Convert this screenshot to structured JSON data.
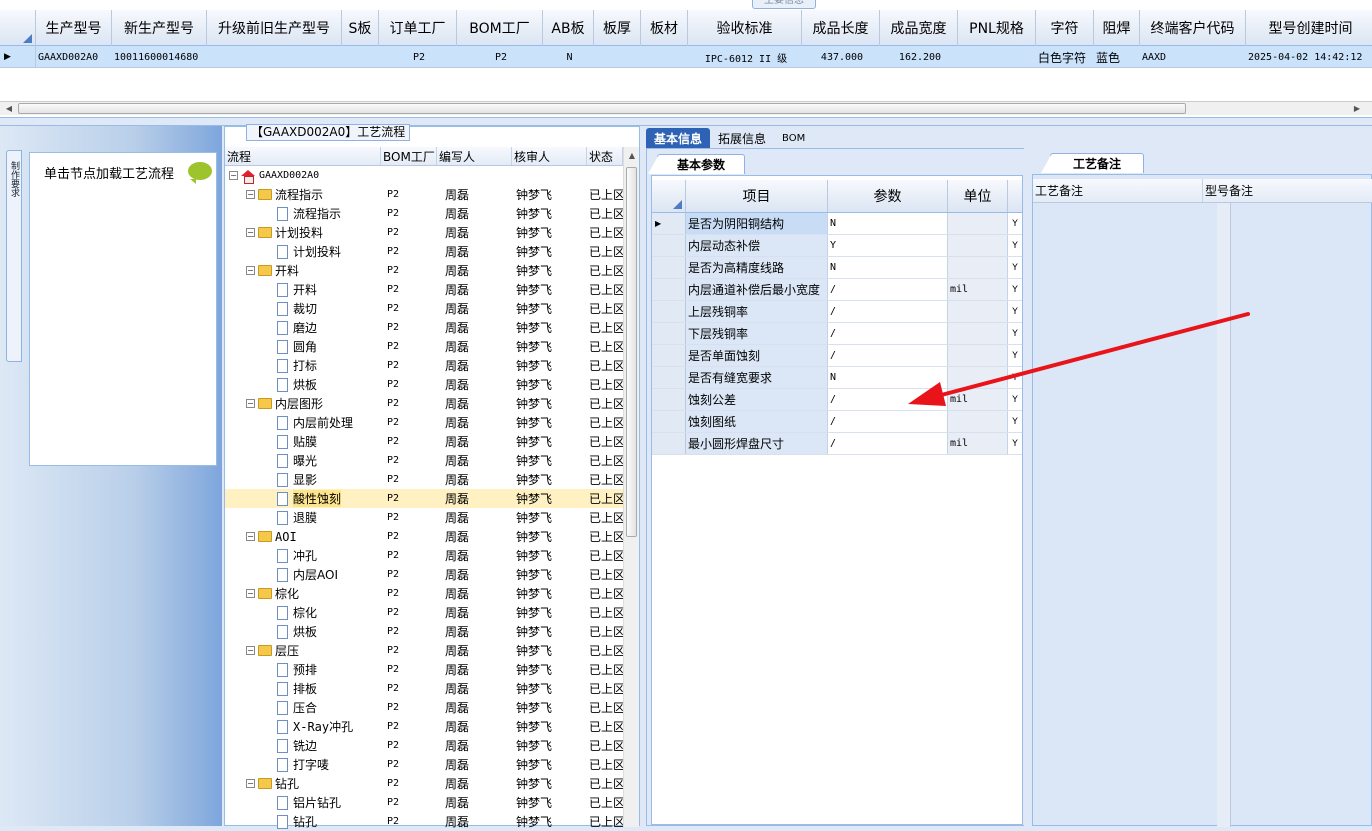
{
  "top_grid": {
    "tab_label": "主要信息",
    "columns": [
      {
        "label": "生产型号",
        "w": 76
      },
      {
        "label": "新生产型号",
        "w": 95
      },
      {
        "label": "升级前旧生产型号",
        "w": 135
      },
      {
        "label": "S板",
        "w": 37
      },
      {
        "label": "订单工厂",
        "w": 78
      },
      {
        "label": "BOM工厂",
        "w": 86
      },
      {
        "label": "AB板",
        "w": 51
      },
      {
        "label": "板厚",
        "w": 47
      },
      {
        "label": "板材",
        "w": 47
      },
      {
        "label": "验收标准",
        "w": 114
      },
      {
        "label": "成品长度",
        "w": 78
      },
      {
        "label": "成品宽度",
        "w": 78
      },
      {
        "label": "PNL规格",
        "w": 78
      },
      {
        "label": "字符",
        "w": 58
      },
      {
        "label": "阻焊",
        "w": 46
      },
      {
        "label": "终端客户代码",
        "w": 106
      },
      {
        "label": "型号创建时间",
        "w": 130
      }
    ],
    "row": [
      "GAAXD002A0",
      "10011600014680",
      "",
      "",
      "P2",
      "P2",
      "N",
      "",
      "",
      "IPC-6012 II 级",
      "437.000",
      "162.200",
      "",
      "白色字符",
      "蓝色",
      "AAXD",
      "2025-04-02 14:42:12"
    ]
  },
  "left_panel": {
    "vertical_tab": "制作要求",
    "tip": "单击节点加载工艺流程"
  },
  "tree": {
    "title": "【GAAXD002A0】工艺流程",
    "headers": [
      "流程",
      "BOM工厂",
      "编写人",
      "核审人",
      "状态"
    ],
    "root": "GAAXD002A0",
    "rows": [
      {
        "name": "流程指示",
        "lvl": 1,
        "folder": true
      },
      {
        "name": "流程指示",
        "lvl": 2
      },
      {
        "name": "计划投料",
        "lvl": 1,
        "folder": true
      },
      {
        "name": "计划投料",
        "lvl": 2
      },
      {
        "name": "开料",
        "lvl": 1,
        "folder": true
      },
      {
        "name": "开料",
        "lvl": 2
      },
      {
        "name": "裁切",
        "lvl": 2
      },
      {
        "name": "磨边",
        "lvl": 2
      },
      {
        "name": "圆角",
        "lvl": 2
      },
      {
        "name": "打标",
        "lvl": 2
      },
      {
        "name": "烘板",
        "lvl": 2
      },
      {
        "name": "内层图形",
        "lvl": 1,
        "folder": true
      },
      {
        "name": "内层前处理",
        "lvl": 2
      },
      {
        "name": "贴膜",
        "lvl": 2
      },
      {
        "name": "曝光",
        "lvl": 2
      },
      {
        "name": "显影",
        "lvl": 2
      },
      {
        "name": "酸性蚀刻",
        "lvl": 2,
        "sel": true
      },
      {
        "name": "退膜",
        "lvl": 2
      },
      {
        "name": "AOI",
        "lvl": 1,
        "folder": true
      },
      {
        "name": "冲孔",
        "lvl": 2
      },
      {
        "name": "内层AOI",
        "lvl": 2
      },
      {
        "name": "棕化",
        "lvl": 1,
        "folder": true
      },
      {
        "name": "棕化",
        "lvl": 2
      },
      {
        "name": "烘板",
        "lvl": 2
      },
      {
        "name": "层压",
        "lvl": 1,
        "folder": true
      },
      {
        "name": "预排",
        "lvl": 2
      },
      {
        "name": "排板",
        "lvl": 2
      },
      {
        "name": "压合",
        "lvl": 2
      },
      {
        "name": "X-Ray冲孔",
        "lvl": 2
      },
      {
        "name": "铣边",
        "lvl": 2
      },
      {
        "name": "打字唛",
        "lvl": 2
      },
      {
        "name": "钻孔",
        "lvl": 1,
        "folder": true
      },
      {
        "name": "铝片钻孔",
        "lvl": 2
      },
      {
        "name": "钻孔",
        "lvl": 2
      }
    ],
    "bom": "P2",
    "writer": "周磊",
    "reviewer": "钟梦飞",
    "status": "已上区"
  },
  "mid": {
    "tabs": [
      "基本信息",
      "拓展信息",
      "BOM"
    ],
    "subtab": "基本参数",
    "headers": [
      "项目",
      "参数",
      "单位"
    ],
    "rows": [
      {
        "item": "是否为阴阳铜结构",
        "param": "N",
        "unit": "",
        "y": "Y"
      },
      {
        "item": "内层动态补偿",
        "param": "Y",
        "unit": "",
        "y": "Y"
      },
      {
        "item": "是否为高精度线路",
        "param": "N",
        "unit": "",
        "y": "Y"
      },
      {
        "item": "内层通道补偿后最小宽度",
        "param": "/",
        "unit": "mil",
        "y": "Y"
      },
      {
        "item": "上层残铜率",
        "param": "/",
        "unit": "",
        "y": "Y"
      },
      {
        "item": "下层残铜率",
        "param": "/",
        "unit": "",
        "y": "Y"
      },
      {
        "item": "是否单面蚀刻",
        "param": "/",
        "unit": "",
        "y": "Y"
      },
      {
        "item": "是否有缝宽要求",
        "param": "N",
        "unit": "",
        "y": "Y"
      },
      {
        "item": "蚀刻公差",
        "param": "/",
        "unit": "mil",
        "y": "Y"
      },
      {
        "item": "蚀刻图纸",
        "param": "/",
        "unit": "",
        "y": "Y"
      },
      {
        "item": "最小圆形焊盘尺寸",
        "param": "/",
        "unit": "mil",
        "y": "Y"
      }
    ]
  },
  "right": {
    "tab": "工艺备注",
    "headers": [
      "工艺备注",
      "型号备注"
    ]
  },
  "colors": {
    "accent": "#2d62b5",
    "selected_row": "#fde58b",
    "arrow": "#e8141a"
  }
}
